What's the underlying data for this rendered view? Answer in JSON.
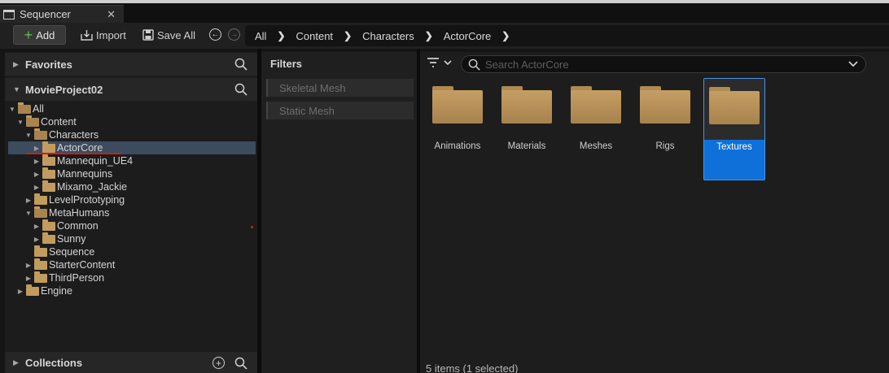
{
  "window": {
    "tab_title": "Sequencer",
    "close_glyph": "✕"
  },
  "toolbar": {
    "add_label": "Add",
    "import_label": "Import",
    "save_all_label": "Save All",
    "back_icon": "arrow-left-circle-icon",
    "forward_icon": "arrow-right-circle-icon"
  },
  "breadcrumb": [
    "All",
    "Content",
    "Characters",
    "ActorCore"
  ],
  "sections": {
    "favorites": "Favorites",
    "project": "MovieProject02",
    "collections": "Collections"
  },
  "tree": [
    {
      "label": "All",
      "depth": 0,
      "expanded": true,
      "selected": false
    },
    {
      "label": "Content",
      "depth": 1,
      "expanded": true,
      "selected": false
    },
    {
      "label": "Characters",
      "depth": 2,
      "expanded": true,
      "selected": false
    },
    {
      "label": "ActorCore",
      "depth": 3,
      "expanded": false,
      "selected": true
    },
    {
      "label": "Mannequin_UE4",
      "depth": 3,
      "expanded": false,
      "selected": false
    },
    {
      "label": "Mannequins",
      "depth": 3,
      "expanded": false,
      "selected": false
    },
    {
      "label": "Mixamo_Jackie",
      "depth": 3,
      "expanded": false,
      "selected": false
    },
    {
      "label": "LevelPrototyping",
      "depth": 2,
      "expanded": false,
      "selected": false
    },
    {
      "label": "MetaHumans",
      "depth": 2,
      "expanded": true,
      "selected": false
    },
    {
      "label": "Common",
      "depth": 3,
      "expanded": false,
      "selected": false
    },
    {
      "label": "Sunny",
      "depth": 3,
      "expanded": false,
      "selected": false
    },
    {
      "label": "Sequence",
      "depth": 2,
      "expanded": null,
      "selected": false
    },
    {
      "label": "StarterContent",
      "depth": 2,
      "expanded": false,
      "selected": false
    },
    {
      "label": "ThirdPerson",
      "depth": 2,
      "expanded": false,
      "selected": false
    },
    {
      "label": "Engine",
      "depth": 1,
      "expanded": false,
      "selected": false
    }
  ],
  "filters": {
    "title": "Filters",
    "items": [
      "Skeletal Mesh",
      "Static Mesh"
    ]
  },
  "search": {
    "placeholder": "Search ActorCore"
  },
  "assets": [
    {
      "name": "Animations",
      "selected": false
    },
    {
      "name": "Materials",
      "selected": false
    },
    {
      "name": "Meshes",
      "selected": false
    },
    {
      "name": "Rigs",
      "selected": false
    },
    {
      "name": "Textures",
      "selected": true
    }
  ],
  "status": "5 items (1 selected)",
  "colors": {
    "accent": "#0e70d8",
    "folder": "#c19c5e",
    "selection_row": "#3c4b5e",
    "annotation_red": "#d61a1a"
  }
}
